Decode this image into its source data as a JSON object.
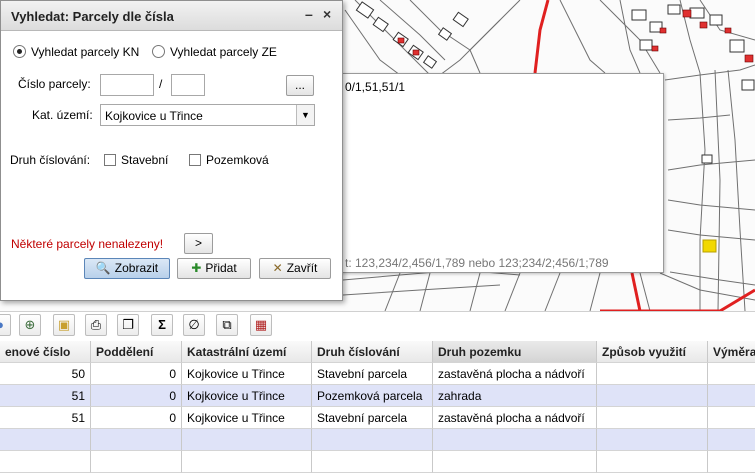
{
  "dialog": {
    "title": "Vyhledat: Parcely dle čísla",
    "minimize_icon": "minimize-icon",
    "close_icon": "close-icon",
    "radio_kn_label": "Vyhledat parcely KN",
    "radio_ze_label": "Vyhledat parcely ZE",
    "cislo_label": "Číslo parcely:",
    "cislo_value1": "",
    "cislo_value2": "",
    "slash": "/",
    "more_button": "...",
    "kat_label": "Kat. území:",
    "kat_value": "Kojkovice u Třince",
    "druh_label": "Druh číslování:",
    "stavebni_label": "Stavební",
    "pozemkova_label": "Pozemková",
    "error_text": "Některé parcely nenalezeny!",
    "expand_button": ">",
    "zobrazit_label": "Zobrazit",
    "pridat_label": "Přidat",
    "zavrit_label": "Zavřít"
  },
  "popup": {
    "text1": "0/1,51,51/1",
    "text2": "t:  123,234/2,456/1,789  nebo 123;234/2;456/1;789"
  },
  "toolbar": [
    "circle-icon",
    "zoom-to-icon",
    "image-icon",
    "print-icon",
    "copy-icon",
    "sum-icon",
    "null-icon",
    "layers-icon",
    "table-icon"
  ],
  "grid": {
    "columns": [
      "enové číslo",
      "Poddělení",
      "Katastrální území",
      "Druh číslování",
      "Druh pozemku",
      "Způsob využití",
      "Výměra"
    ],
    "rows": [
      [
        "50",
        "0",
        "Kojkovice u Třince",
        "Stavební parcela",
        "zastavěná plocha a nádvoří",
        "",
        ""
      ],
      [
        "51",
        "0",
        "Kojkovice u Třince",
        "Pozemková parcela",
        "zahrada",
        "",
        ""
      ],
      [
        "51",
        "0",
        "Kojkovice u Třince",
        "Stavební parcela",
        "zastavěná plocha a nádvoří",
        "",
        ""
      ]
    ]
  },
  "colors": {
    "error": "#c00000",
    "road": "#e02020",
    "selected_row": "#dfe3f8"
  }
}
